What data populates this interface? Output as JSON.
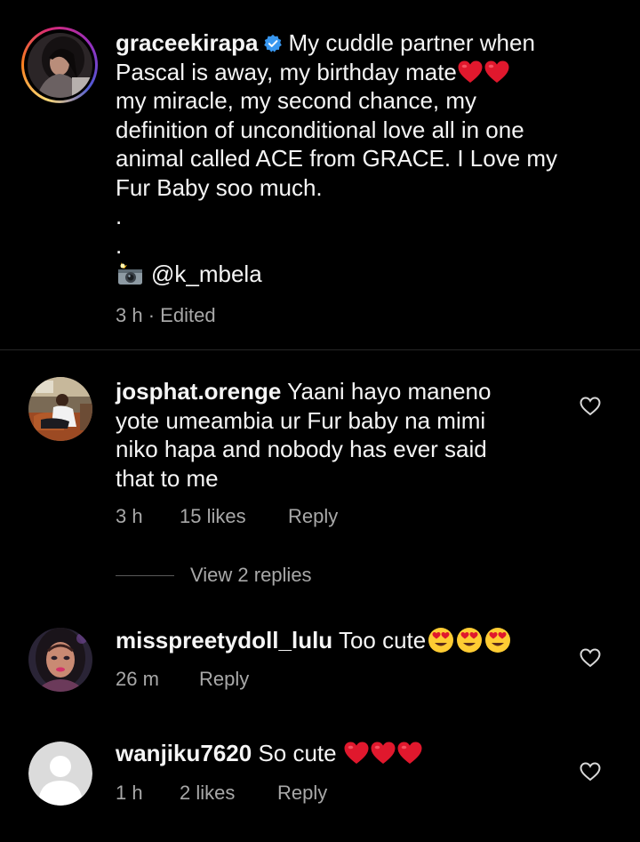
{
  "caption": {
    "username": "graceekirapa",
    "line1": "My cuddle partner when",
    "line2": "Pascal is away, my birthday mate",
    "line3": "my miracle, my second chance, my",
    "line4": "definition of unconditional love all in one",
    "line5": "animal called ACE from GRACE. I Love my",
    "line6": "Fur Baby soo much.",
    "dot1": ".",
    "dot2": ".",
    "photo_credit": "@k_mbela",
    "time": "3 h",
    "separator": "·",
    "edited": "Edited"
  },
  "comments": [
    {
      "username": "josphat.orenge",
      "line1": "Yaani hayo maneno",
      "line2": "yote umeambia ur Fur baby na mimi",
      "line3": "niko hapa and nobody has ever said",
      "line4": "that to me",
      "time": "3 h",
      "likes": "15 likes",
      "reply": "Reply",
      "view_replies": "View 2 replies"
    },
    {
      "username": "misspreetydoll_lulu",
      "text": "Too cute",
      "time": "26 m",
      "reply": "Reply"
    },
    {
      "username": "wanjiku7620",
      "text": "So cute",
      "time": "1 h",
      "likes": "2 likes",
      "reply": "Reply"
    }
  ],
  "icons": {
    "verified": "verified-badge-icon",
    "heart_emoji": "red-heart-emoji",
    "camera_emoji": "camera-flash-emoji",
    "heart_eyes_emoji": "heart-eyes-emoji",
    "like": "heart-outline-icon",
    "default_avatar": "default-avatar-icon"
  },
  "colors": {
    "background": "#000000",
    "text_primary": "#f5f5f5",
    "text_secondary": "#a8a8a8",
    "verified_blue": "#3897f0",
    "heart_red": "#e0182d",
    "divider": "#262626"
  }
}
